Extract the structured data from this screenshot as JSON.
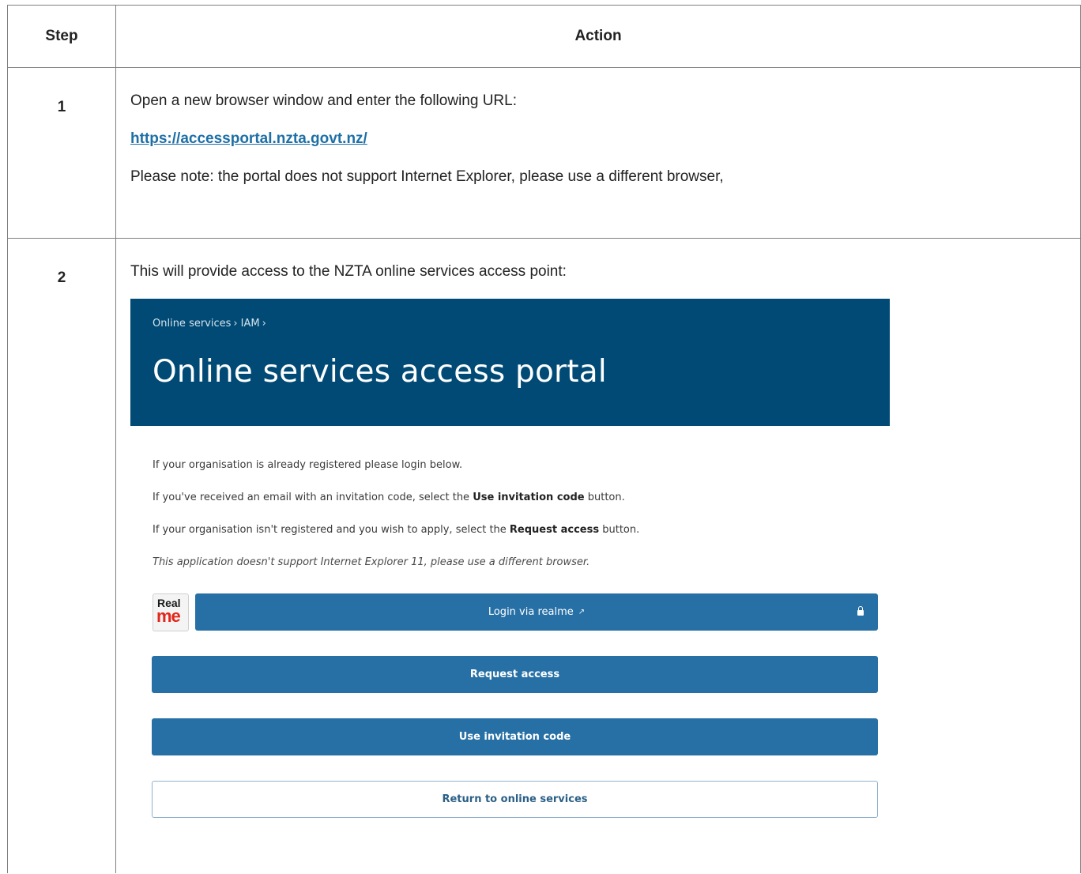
{
  "table": {
    "headers": {
      "step": "Step",
      "action": "Action"
    },
    "rows": [
      {
        "step": "1",
        "lines": [
          "Open a new browser window and enter the following URL:",
          "https://accessportal.nzta.govt.nz/",
          "Please note: the portal does not support Internet Explorer, please use a different browser,"
        ]
      },
      {
        "step": "2",
        "lines": [
          "This will provide access to the NZTA online services access point:"
        ]
      }
    ]
  },
  "portal": {
    "breadcrumb": [
      "Online services",
      "IAM"
    ],
    "breadcrumb_separator": "›",
    "title": "Online services access portal",
    "intro": "If your organisation is already registered please login below.",
    "invite_text": {
      "before": "If you've received an email with an invitation code, select the ",
      "bold": "Use invitation code",
      "after": " button."
    },
    "request_text": {
      "before": "If your organisation isn't registered and you wish to apply, select the ",
      "bold": "Request access",
      "after": " button."
    },
    "ie_note": "This application doesn't support Internet Explorer 11, please use a different browser.",
    "realme_logo": {
      "top": "Real",
      "bottom": "me"
    },
    "buttons": {
      "login": "Login via realme",
      "request": "Request access",
      "invite": "Use invitation code",
      "return": "Return to online services"
    },
    "colors": {
      "banner": "#004a75",
      "button": "#2770a5",
      "link": "#1d6fa6"
    }
  }
}
